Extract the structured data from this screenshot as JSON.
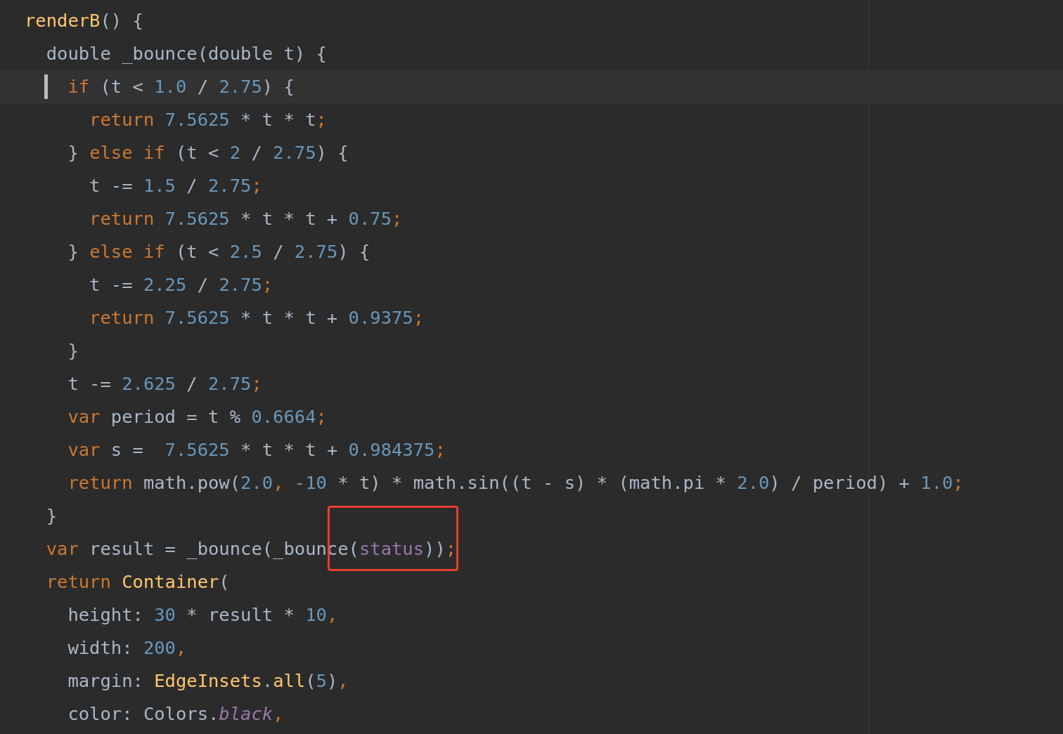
{
  "editor": {
    "lines": [
      {
        "current": false,
        "tokens": [
          {
            "text": "renderB",
            "kind": "function"
          },
          {
            "text": "() {",
            "kind": "plain"
          }
        ]
      },
      {
        "current": false,
        "tokens": [
          {
            "text": "  double _bounce(double t) {",
            "kind": "plain"
          }
        ]
      },
      {
        "current": true,
        "tokens": [
          {
            "text": "    if",
            "kind": "keyword"
          },
          {
            "text": " (t < ",
            "kind": "plain"
          },
          {
            "text": "1.0",
            "kind": "number"
          },
          {
            "text": " / ",
            "kind": "plain"
          },
          {
            "text": "2.75",
            "kind": "number"
          },
          {
            "text": ") {",
            "kind": "plain"
          }
        ]
      },
      {
        "current": false,
        "tokens": [
          {
            "text": "      return",
            "kind": "keyword"
          },
          {
            "text": " 7.5625",
            "kind": "number"
          },
          {
            "text": " * t * t",
            "kind": "plain"
          },
          {
            "text": ";",
            "kind": "punct"
          }
        ]
      },
      {
        "current": false,
        "tokens": [
          {
            "text": "    } ",
            "kind": "plain"
          },
          {
            "text": "else if",
            "kind": "keyword"
          },
          {
            "text": " (t < ",
            "kind": "plain"
          },
          {
            "text": "2",
            "kind": "number"
          },
          {
            "text": " / ",
            "kind": "plain"
          },
          {
            "text": "2.75",
            "kind": "number"
          },
          {
            "text": ") {",
            "kind": "plain"
          }
        ]
      },
      {
        "current": false,
        "tokens": [
          {
            "text": "      t -= ",
            "kind": "plain"
          },
          {
            "text": "1.5",
            "kind": "number"
          },
          {
            "text": " / ",
            "kind": "plain"
          },
          {
            "text": "2.75",
            "kind": "number"
          },
          {
            "text": ";",
            "kind": "punct"
          }
        ]
      },
      {
        "current": false,
        "tokens": [
          {
            "text": "      return",
            "kind": "keyword"
          },
          {
            "text": " 7.5625",
            "kind": "number"
          },
          {
            "text": " * t * t + ",
            "kind": "plain"
          },
          {
            "text": "0.75",
            "kind": "number"
          },
          {
            "text": ";",
            "kind": "punct"
          }
        ]
      },
      {
        "current": false,
        "tokens": [
          {
            "text": "    } ",
            "kind": "plain"
          },
          {
            "text": "else if",
            "kind": "keyword"
          },
          {
            "text": " (t < ",
            "kind": "plain"
          },
          {
            "text": "2.5",
            "kind": "number"
          },
          {
            "text": " / ",
            "kind": "plain"
          },
          {
            "text": "2.75",
            "kind": "number"
          },
          {
            "text": ") {",
            "kind": "plain"
          }
        ]
      },
      {
        "current": false,
        "tokens": [
          {
            "text": "      t -= ",
            "kind": "plain"
          },
          {
            "text": "2.25",
            "kind": "number"
          },
          {
            "text": " / ",
            "kind": "plain"
          },
          {
            "text": "2.75",
            "kind": "number"
          },
          {
            "text": ";",
            "kind": "punct"
          }
        ]
      },
      {
        "current": false,
        "tokens": [
          {
            "text": "      return",
            "kind": "keyword"
          },
          {
            "text": " 7.5625",
            "kind": "number"
          },
          {
            "text": " * t * t + ",
            "kind": "plain"
          },
          {
            "text": "0.9375",
            "kind": "number"
          },
          {
            "text": ";",
            "kind": "punct"
          }
        ]
      },
      {
        "current": false,
        "tokens": [
          {
            "text": "    }",
            "kind": "plain"
          }
        ]
      },
      {
        "current": false,
        "tokens": [
          {
            "text": "    t -= ",
            "kind": "plain"
          },
          {
            "text": "2.625",
            "kind": "number"
          },
          {
            "text": " / ",
            "kind": "plain"
          },
          {
            "text": "2.75",
            "kind": "number"
          },
          {
            "text": ";",
            "kind": "punct"
          }
        ]
      },
      {
        "current": false,
        "tokens": [
          {
            "text": "    var",
            "kind": "keyword"
          },
          {
            "text": " period = t % ",
            "kind": "plain"
          },
          {
            "text": "0.6664",
            "kind": "number"
          },
          {
            "text": ";",
            "kind": "punct"
          }
        ]
      },
      {
        "current": false,
        "tokens": [
          {
            "text": "    var",
            "kind": "keyword"
          },
          {
            "text": " s =  ",
            "kind": "plain"
          },
          {
            "text": "7.5625",
            "kind": "number"
          },
          {
            "text": " * t * t + ",
            "kind": "plain"
          },
          {
            "text": "0.984375",
            "kind": "number"
          },
          {
            "text": ";",
            "kind": "punct"
          }
        ]
      },
      {
        "current": false,
        "tokens": [
          {
            "text": "    return",
            "kind": "keyword"
          },
          {
            "text": " math.pow(",
            "kind": "plain"
          },
          {
            "text": "2.0",
            "kind": "number"
          },
          {
            "text": ",",
            "kind": "punct"
          },
          {
            "text": " -10",
            "kind": "number"
          },
          {
            "text": " * t) * math.sin((t - s) * (math.pi * ",
            "kind": "plain"
          },
          {
            "text": "2.0",
            "kind": "number"
          },
          {
            "text": ") / period) + ",
            "kind": "plain"
          },
          {
            "text": "1.0",
            "kind": "number"
          },
          {
            "text": ";",
            "kind": "punct"
          }
        ]
      },
      {
        "current": false,
        "tokens": [
          {
            "text": "  }",
            "kind": "plain"
          }
        ]
      },
      {
        "current": false,
        "tokens": [
          {
            "text": "  var",
            "kind": "keyword"
          },
          {
            "text": " result = _bounce(_bounce(",
            "kind": "plain"
          },
          {
            "text": "status",
            "kind": "field"
          },
          {
            "text": "))",
            "kind": "plain"
          },
          {
            "text": ";",
            "kind": "punct"
          }
        ]
      },
      {
        "current": false,
        "tokens": [
          {
            "text": "  return",
            "kind": "keyword"
          },
          {
            "text": " Container",
            "kind": "function"
          },
          {
            "text": "(",
            "kind": "plain"
          }
        ]
      },
      {
        "current": false,
        "tokens": [
          {
            "text": "    height: ",
            "kind": "plain"
          },
          {
            "text": "30",
            "kind": "number"
          },
          {
            "text": " * result * ",
            "kind": "plain"
          },
          {
            "text": "10",
            "kind": "number"
          },
          {
            "text": ",",
            "kind": "punct"
          }
        ]
      },
      {
        "current": false,
        "tokens": [
          {
            "text": "    width: ",
            "kind": "plain"
          },
          {
            "text": "200",
            "kind": "number"
          },
          {
            "text": ",",
            "kind": "punct"
          }
        ]
      },
      {
        "current": false,
        "tokens": [
          {
            "text": "    margin: ",
            "kind": "plain"
          },
          {
            "text": "EdgeInsets",
            "kind": "function"
          },
          {
            "text": ".",
            "kind": "plain"
          },
          {
            "text": "all",
            "kind": "function"
          },
          {
            "text": "(",
            "kind": "plain"
          },
          {
            "text": "5",
            "kind": "number"
          },
          {
            "text": ")",
            "kind": "plain"
          },
          {
            "text": ",",
            "kind": "punct"
          }
        ]
      },
      {
        "current": false,
        "tokens": [
          {
            "text": "    color: Colors.",
            "kind": "plain"
          },
          {
            "text": "black",
            "kind": "italic-field"
          },
          {
            "text": ",",
            "kind": "punct"
          }
        ]
      }
    ]
  }
}
